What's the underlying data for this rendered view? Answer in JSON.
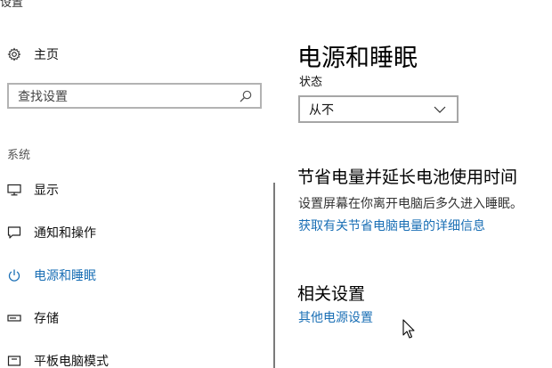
{
  "window": {
    "title": "设置",
    "title_right": "—"
  },
  "sidebar": {
    "home_label": "主页",
    "search_placeholder": "查找设置",
    "section_label": "系统",
    "items": [
      {
        "label": "显示",
        "icon": "monitor-icon"
      },
      {
        "label": "通知和操作",
        "icon": "notification-icon"
      },
      {
        "label": "电源和睡眠",
        "icon": "power-icon",
        "active": true
      },
      {
        "label": "存储",
        "icon": "storage-icon"
      },
      {
        "label": "平板电脑模式",
        "icon": "tablet-mode-icon"
      }
    ]
  },
  "main": {
    "title": "电源和睡眠",
    "status_label": "状态",
    "status_value": "从不",
    "battery_section": {
      "heading": "节省电量并延长电池使用时间",
      "description": "设置屏幕在你离开电脑后多久进入睡眠。",
      "link": "获取有关节省电脑电量的详细信息"
    },
    "related_section": {
      "heading": "相关设置",
      "link": "其他电源设置"
    }
  },
  "colors": {
    "accent": "#1a6fb5",
    "text": "#000000",
    "border": "#a6a6a6"
  }
}
